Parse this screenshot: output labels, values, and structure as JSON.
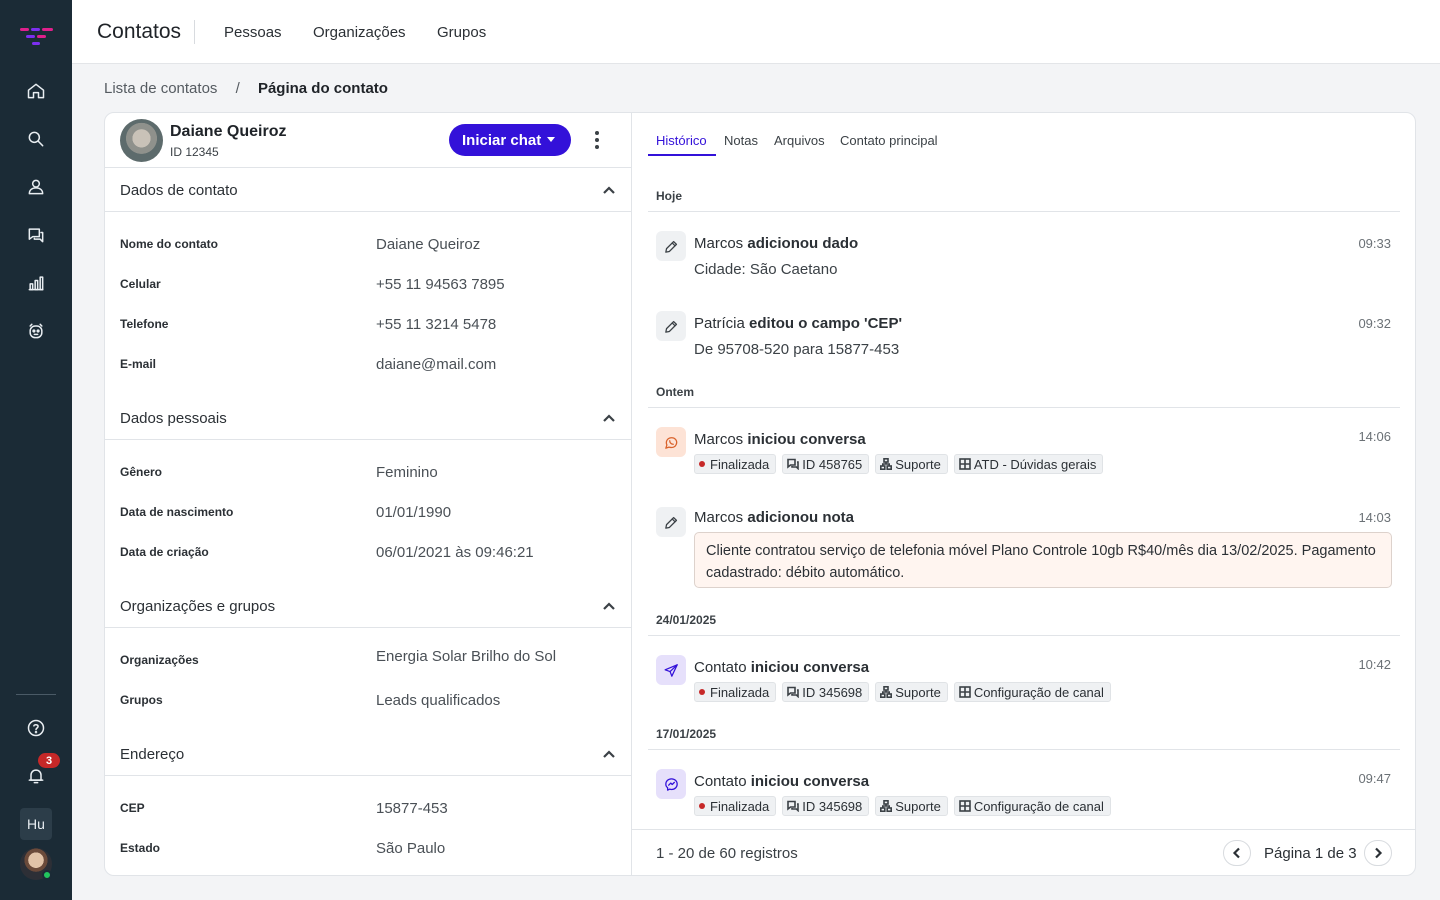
{
  "app": {
    "title": "Contatos",
    "nav_tabs": [
      "Pessoas",
      "Organizações",
      "Grupos"
    ]
  },
  "sidebar": {
    "items": [
      {
        "icon": "home-icon"
      },
      {
        "icon": "search-icon"
      },
      {
        "icon": "user-icon"
      },
      {
        "icon": "chat-icon"
      },
      {
        "icon": "reports-icon"
      },
      {
        "icon": "bot-icon"
      }
    ],
    "notification_count": "3",
    "workspace_initials": "Hu"
  },
  "breadcrumb": {
    "parent": "Lista de contatos",
    "separator": "/",
    "current": "Página do contato"
  },
  "contact": {
    "name": "Daiane Queiroz",
    "id": "ID 12345",
    "chat_button": "Iniciar chat",
    "sections": {
      "contact_data": {
        "title": "Dados de contato",
        "fields": [
          {
            "label": "Nome do contato",
            "value": "Daiane Queiroz"
          },
          {
            "label": "Celular",
            "value": "+55 11 94563 7895"
          },
          {
            "label": "Telefone",
            "value": "+55 11 3214 5478"
          },
          {
            "label": "E-mail",
            "value": "daiane@mail.com"
          }
        ]
      },
      "personal_data": {
        "title": "Dados pessoais",
        "fields": [
          {
            "label": "Gênero",
            "value": "Feminino"
          },
          {
            "label": "Data de nascimento",
            "value": "01/01/1990"
          },
          {
            "label": "Data de criação",
            "value": "06/01/2021 às 09:46:21"
          }
        ]
      },
      "orgs_groups": {
        "title": "Organizações e grupos",
        "fields": [
          {
            "label": "Organizações",
            "value": "Energia Solar Brilho do Sol"
          },
          {
            "label": "Grupos",
            "value": "Leads qualificados"
          }
        ]
      },
      "address": {
        "title": "Endereço",
        "fields": [
          {
            "label": "CEP",
            "value": "15877-453"
          },
          {
            "label": "Estado",
            "value": "São Paulo"
          }
        ]
      }
    }
  },
  "history": {
    "tabs": [
      "Histórico",
      "Notas",
      "Arquivos",
      "Contato principal"
    ],
    "days": [
      "Hoje",
      "Ontem",
      "24/01/2025",
      "17/01/2025"
    ],
    "events": [
      {
        "actor": "Marcos",
        "action": "adicionou dado",
        "time": "09:33",
        "detail": "Cidade: São Caetano",
        "icon": "pencil-icon"
      },
      {
        "actor": "Patrícia",
        "action": "editou o campo 'CEP'",
        "time": "09:32",
        "detail": "De 95708-520 para 15877-453",
        "icon": "pencil-icon"
      },
      {
        "actor": "Marcos",
        "action": "iniciou conversa",
        "time": "14:06",
        "icon": "whatsapp-icon",
        "chips": {
          "status": "Finalizada",
          "id": "ID 458765",
          "team": "Suporte",
          "queue": "ATD - Dúvidas gerais"
        }
      },
      {
        "actor": "Marcos",
        "action": "adicionou nota",
        "time": "14:03",
        "icon": "pencil-icon",
        "note": "Cliente contratou serviço de telefonia móvel Plano Controle 10gb R$40/mês dia 13/02/2025. Pagamento cadastrado: débito automático."
      },
      {
        "actor": "Contato",
        "action": "iniciou conversa",
        "time": "10:42",
        "icon": "telegram-icon",
        "chips": {
          "status": "Finalizada",
          "id": "ID 345698",
          "team": "Suporte",
          "queue": "Configuração de canal"
        }
      },
      {
        "actor": "Contato",
        "action": "iniciou conversa",
        "time": "09:47",
        "icon": "messenger-icon",
        "chips": {
          "status": "Finalizada",
          "id": "ID 345698",
          "team": "Suporte",
          "queue": "Configuração de canal"
        }
      }
    ],
    "footer": {
      "count": "1 - 20 de 60 registros",
      "page": "Página 1 de 3"
    }
  },
  "colors": {
    "sidebar": "#1b2b36",
    "accent": "#3311d9",
    "status_dot": "#c62828",
    "note_bg": "#fff5f0"
  }
}
